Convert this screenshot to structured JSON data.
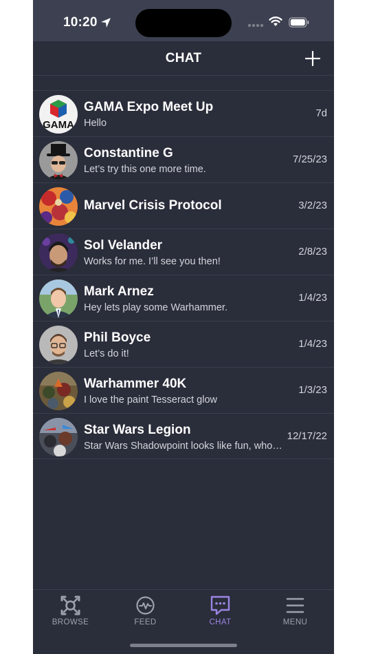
{
  "status_bar": {
    "time": "10:20",
    "icons": [
      "location-arrow-icon",
      "signal-dots-icon",
      "wifi-icon",
      "battery-icon"
    ]
  },
  "header": {
    "title": "CHAT",
    "add_icon": "plus-icon"
  },
  "chats": [
    {
      "name": "GAMA Expo Meet Up",
      "message": "Hello",
      "date": "7d",
      "avatar": "gama-logo-avatar"
    },
    {
      "name": "Constantine G",
      "message": "Let’s try this one more time.",
      "date": "7/25/23",
      "avatar": "top-hat-man-avatar"
    },
    {
      "name": "Marvel Crisis Protocol",
      "message": "",
      "date": "3/2/23",
      "avatar": "marvel-heroes-avatar"
    },
    {
      "name": "Sol Velander",
      "message": "Works for me. I’ll see you then!",
      "date": "2/8/23",
      "avatar": "man-portrait-avatar"
    },
    {
      "name": "Mark Arnez",
      "message": "Hey lets play some Warhammer.",
      "date": "1/4/23",
      "avatar": "man-suit-avatar"
    },
    {
      "name": "Phil Boyce",
      "message": "Let’s do it!",
      "date": "1/4/23",
      "avatar": "man-glasses-avatar"
    },
    {
      "name": "Warhammer 40K",
      "message": "I love the paint Tesseract glow",
      "date": "1/3/23",
      "avatar": "warhammer-battle-avatar"
    },
    {
      "name": "Star Wars Legion",
      "message": "Star Wars Shadowpoint looks like fun, who’s...",
      "date": "12/17/22",
      "avatar": "star-wars-battle-avatar"
    }
  ],
  "tabbar": {
    "tabs": [
      {
        "label": "BROWSE",
        "icon": "browse-icon",
        "active": false
      },
      {
        "label": "FEED",
        "icon": "feed-pulse-icon",
        "active": false
      },
      {
        "label": "CHAT",
        "icon": "chat-bubble-icon",
        "active": true
      },
      {
        "label": "MENU",
        "icon": "hamburger-menu-icon",
        "active": false
      }
    ]
  },
  "colors": {
    "background": "#2a2d3a",
    "status_bar": "#3c4050",
    "accent": "#9b86e3",
    "text_primary": "#ffffff",
    "text_secondary": "#d4d6dd",
    "tab_inactive": "#9ea2ad"
  }
}
